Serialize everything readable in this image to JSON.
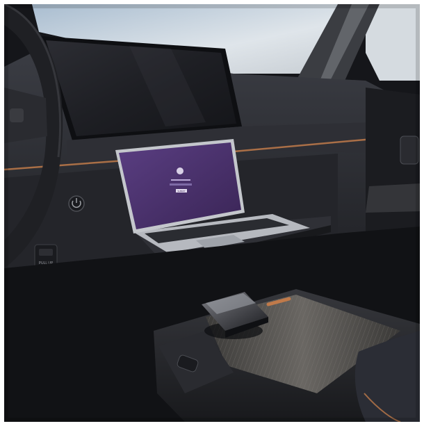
{
  "photo": {
    "subject": "car-interior-with-laptop-on-fold-out-dashboard-tray",
    "colors": {
      "sky": "#c9d3dd",
      "dashboard": "#2a2b30",
      "accent_trim": "#c07a4a",
      "laptop_screen": "#4a2f6a",
      "console_wood": "#4a4946"
    }
  },
  "laptop_screen": {
    "button_label": "SUBMIT"
  },
  "switch_panel": {
    "label": "PULL UP"
  }
}
